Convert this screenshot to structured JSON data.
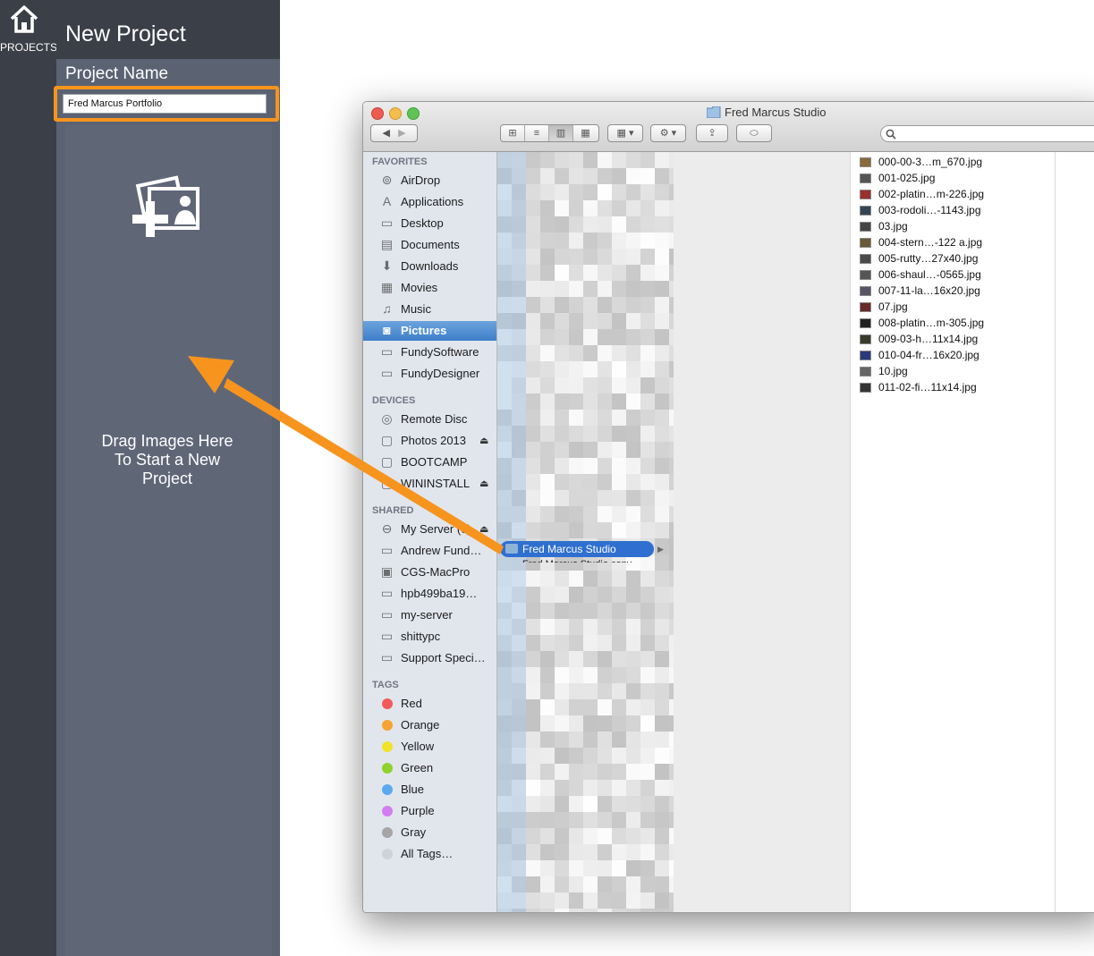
{
  "app": {
    "projects_label": "PROJECTS",
    "panel_title": "New Project",
    "project_name_label": "Project Name",
    "project_name_value": "Fred Marcus Portfolio",
    "drop_text_line1": "Drag Images Here",
    "drop_text_line2": "To Start a New",
    "drop_text_line3": "Project",
    "accent_color": "#f7941d"
  },
  "finder": {
    "title": "Fred Marcus Studio",
    "sections": {
      "favorites": "FAVORITES",
      "devices": "DEVICES",
      "shared": "SHARED",
      "tags": "TAGS"
    },
    "favorites": [
      {
        "label": "AirDrop",
        "icon": "airdrop-icon"
      },
      {
        "label": "Applications",
        "icon": "applications-icon"
      },
      {
        "label": "Desktop",
        "icon": "desktop-icon"
      },
      {
        "label": "Documents",
        "icon": "documents-icon"
      },
      {
        "label": "Downloads",
        "icon": "downloads-icon"
      },
      {
        "label": "Movies",
        "icon": "movies-icon"
      },
      {
        "label": "Music",
        "icon": "music-icon"
      },
      {
        "label": "Pictures",
        "icon": "pictures-icon"
      },
      {
        "label": "FundySoftware",
        "icon": "folder-icon"
      },
      {
        "label": "FundyDesigner",
        "icon": "folder-icon"
      }
    ],
    "devices": [
      {
        "label": "Remote Disc",
        "icon": "disc-icon"
      },
      {
        "label": "Photos 2013",
        "icon": "drive-icon"
      },
      {
        "label": "BOOTCAMP",
        "icon": "drive-icon"
      },
      {
        "label": "WININSTALL",
        "icon": "drive-icon"
      }
    ],
    "shared": [
      {
        "label": "My Server (6)",
        "icon": "server-icon"
      },
      {
        "label": "Andrew Fund…",
        "icon": "computer-icon"
      },
      {
        "label": "CGS-MacPro",
        "icon": "macpro-icon"
      },
      {
        "label": "hpb499ba19…",
        "icon": "computer-icon"
      },
      {
        "label": "my-server",
        "icon": "computer-icon"
      },
      {
        "label": "shittypc",
        "icon": "computer-icon"
      },
      {
        "label": "Support Speci…",
        "icon": "computer-icon"
      }
    ],
    "tags": [
      {
        "label": "Red",
        "color": "#f25a5a"
      },
      {
        "label": "Orange",
        "color": "#f7a233"
      },
      {
        "label": "Yellow",
        "color": "#f2e22a"
      },
      {
        "label": "Green",
        "color": "#8fd22e"
      },
      {
        "label": "Blue",
        "color": "#5aa9f0"
      },
      {
        "label": "Purple",
        "color": "#d37ef0"
      },
      {
        "label": "Gray",
        "color": "#a5a5a5"
      },
      {
        "label": "All Tags…",
        "color": "#cfd3d9"
      }
    ],
    "selected_folder": "Fred Marcus Studio",
    "next_folder": "Fred Marcus Studio copy",
    "files": [
      "000-00-3…m_670.jpg",
      "001-025.jpg",
      "002-platin…m-226.jpg",
      "003-rodoli…-1143.jpg",
      "03.jpg",
      "004-stern…-122 a.jpg",
      "005-rutty…27x40.jpg",
      "006-shaul…-0565.jpg",
      "007-11-la…16x20.jpg",
      "07.jpg",
      "008-platin…m-305.jpg",
      "009-03-h…11x14.jpg",
      "010-04-fr…16x20.jpg",
      "10.jpg",
      "011-02-fi…11x14.jpg"
    ]
  }
}
